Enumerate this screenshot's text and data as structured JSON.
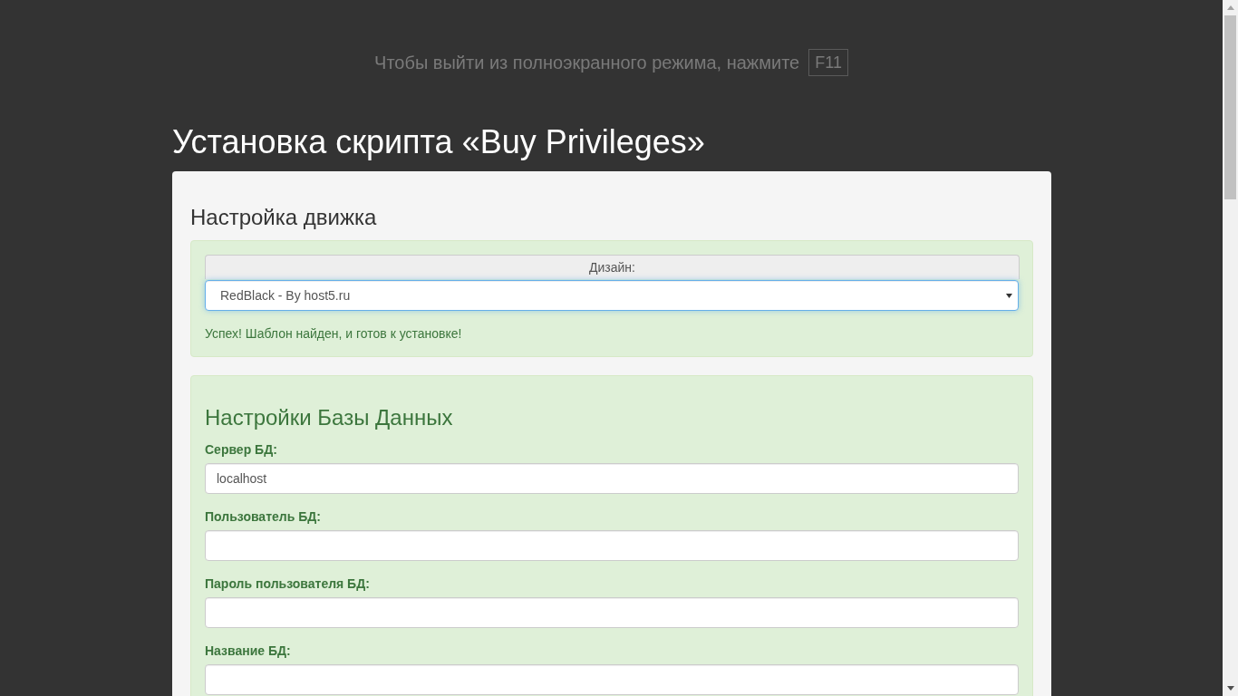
{
  "fullscreen_notice": {
    "text": "Чтобы выйти из полноэкранного режима, нажмите",
    "key": "F11"
  },
  "page_title": "Установка скрипта «Buy Privileges»",
  "engine_section": {
    "heading": "Настройка движка",
    "design_label": "Дизайн:",
    "design_select": {
      "value": "RedBlack - By host5.ru",
      "focused": true
    },
    "status_message": "Успех! Шаблон найден, и готов к установке!"
  },
  "database_section": {
    "heading": "Настройки Базы Данных",
    "fields": [
      {
        "label": "Сервер БД:",
        "value": "localhost"
      },
      {
        "label": "Пользователь БД:"
      },
      {
        "label": "Пароль пользователя БД:"
      },
      {
        "label": "Название БД:"
      }
    ]
  }
}
